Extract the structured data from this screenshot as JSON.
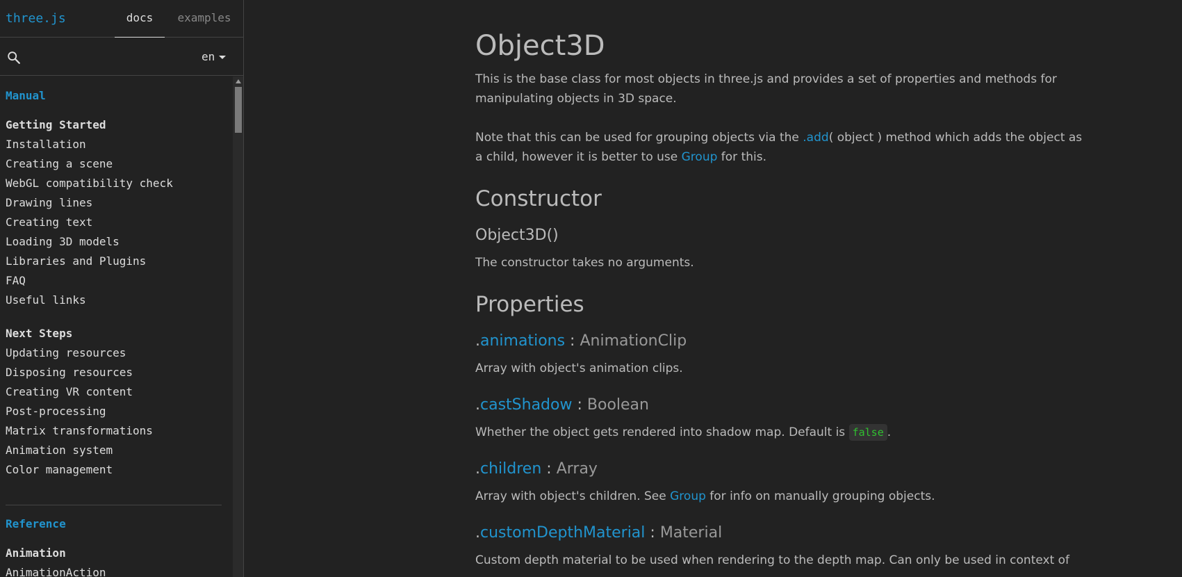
{
  "header": {
    "logo": "three.js",
    "tabs": [
      "docs",
      "examples"
    ]
  },
  "search": {
    "placeholder": "",
    "language": "en"
  },
  "sidebar": {
    "section_manual": "Manual",
    "getting_started": {
      "title": "Getting Started",
      "items": [
        "Installation",
        "Creating a scene",
        "WebGL compatibility check",
        "Drawing lines",
        "Creating text",
        "Loading 3D models",
        "Libraries and Plugins",
        "FAQ",
        "Useful links"
      ]
    },
    "next_steps": {
      "title": "Next Steps",
      "items": [
        "Updating resources",
        "Disposing resources",
        "Creating VR content",
        "Post-processing",
        "Matrix transformations",
        "Animation system",
        "Color management"
      ]
    },
    "section_reference": "Reference",
    "animation": {
      "title": "Animation",
      "items": [
        "AnimationAction"
      ]
    }
  },
  "main": {
    "title": "Object3D",
    "intro": "This is the base class for most objects in three.js and provides a set of properties and methods for manipulating objects in 3D space.",
    "note": {
      "before": "Note that this can be used for grouping objects via the ",
      "add_link": ".add",
      "middle": "( object ) method which adds the object as a child, however it is better to use ",
      "group_link": "Group",
      "after": " for this."
    },
    "constructor_heading": "Constructor",
    "constructor_signature": "Object3D()",
    "constructor_desc": "The constructor takes no arguments.",
    "properties_heading": "Properties",
    "properties": [
      {
        "dot": ".",
        "name": "animations",
        "sep": " : ",
        "type": "AnimationClip",
        "desc": "Array with object's animation clips."
      },
      {
        "dot": ".",
        "name": "castShadow",
        "sep": " : ",
        "type": "Boolean",
        "desc_before": "Whether the object gets rendered into shadow map. Default is ",
        "code": "false",
        "desc_after": "."
      },
      {
        "dot": ".",
        "name": "children",
        "sep": " : ",
        "type": "Array",
        "desc_before": "Array with object's children. See ",
        "link": "Group",
        "desc_after": " for info on manually grouping objects."
      },
      {
        "dot": ".",
        "name": "customDepthMaterial",
        "sep": " : ",
        "type": "Material",
        "desc": "Custom depth material to be used when rendering to the depth map. Can only be used in context of"
      }
    ]
  },
  "colors": {
    "background": "#222222",
    "accent": "#2194ce",
    "text": "#bbbbbb",
    "code": "#30c030"
  }
}
